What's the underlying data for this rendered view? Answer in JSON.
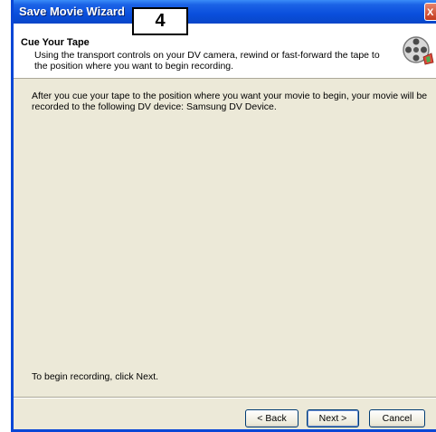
{
  "window": {
    "title": "Save Movie Wizard",
    "close_label": "X"
  },
  "annotation": {
    "step": "4"
  },
  "header": {
    "title": "Cue Your Tape",
    "subtitle": "Using the transport controls on your DV camera, rewind or fast-forward the tape to the position where you want to begin recording.",
    "icon": "film-reel-icon"
  },
  "body": {
    "text": "After you cue your tape to the position where you want your movie to begin, your movie will be recorded to the following DV device: Samsung DV Device.",
    "footer_text": "To begin recording, click Next."
  },
  "buttons": {
    "back": "< Back",
    "next": "Next >",
    "cancel": "Cancel"
  },
  "colors": {
    "titlebar": "#0a4fdc",
    "dialog_bg": "#ece9d8",
    "header_bg": "#ffffff"
  }
}
